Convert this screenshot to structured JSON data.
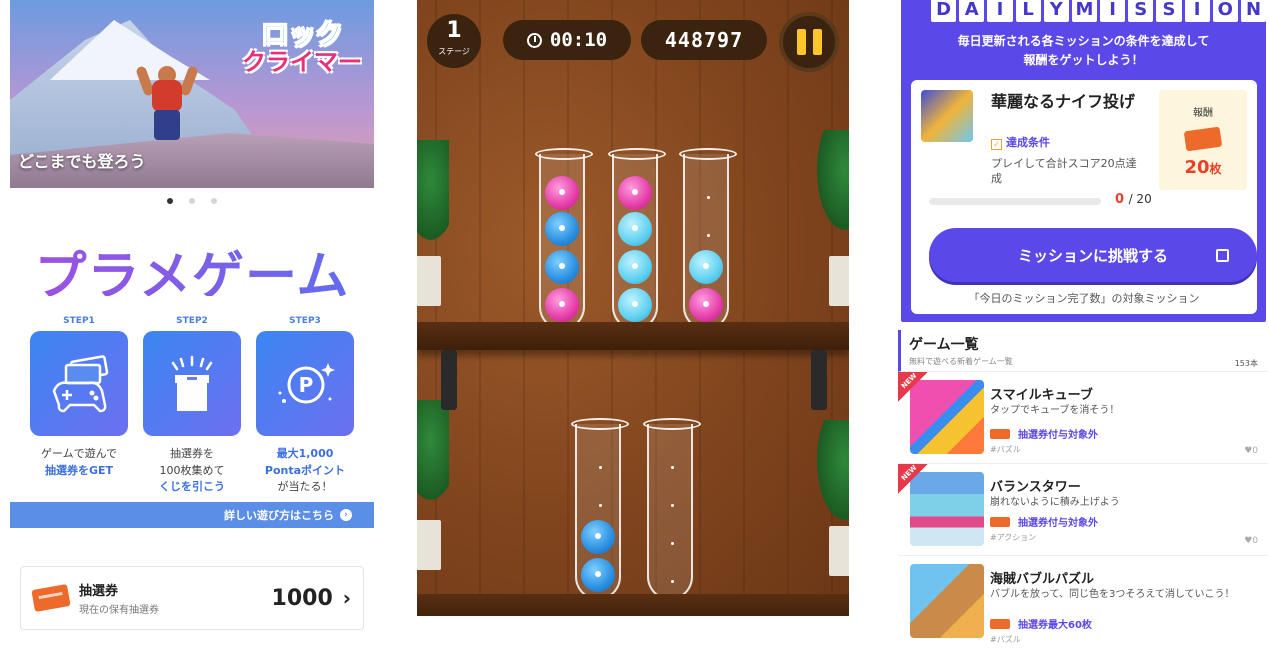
{
  "left": {
    "banner": {
      "title_line1": "ロック",
      "title_line2": "クライマー",
      "caption": "どこまでも登ろう"
    },
    "logo": "プラメゲーム",
    "steps": [
      {
        "label": "STEP1",
        "line1": "ゲームで遊んで",
        "line2": "抽選券をGET",
        "line3": ""
      },
      {
        "label": "STEP2",
        "line1": "抽選券を",
        "line2": "100枚集めて",
        "line3": "くじを引こう"
      },
      {
        "label": "STEP3",
        "line1": "最大1,000",
        "line2": "Pontaポイント",
        "line3": "が当たる！"
      }
    ],
    "howto_link": "詳しい遊び方はこちら",
    "ticket": {
      "title": "抽選券",
      "subtitle": "現在の保有抽選券",
      "count": "1000",
      "arrow": "›"
    }
  },
  "game": {
    "stage_number": "1",
    "stage_label": "ステージ",
    "timer": "00:10",
    "score": "448797"
  },
  "right": {
    "daily_letters": [
      "D",
      "A",
      "I",
      "L",
      "Y",
      "M",
      "I",
      "S",
      "S",
      "I",
      "O",
      "N"
    ],
    "daily_desc_line1": "毎日更新される各ミッションの条件を達成して",
    "daily_desc_line2": "報酬をゲットしよう！",
    "mission": {
      "title": "華麗なるナイフ投げ",
      "condition_label": "達成条件",
      "condition_text": "プレイして合計スコア20点達成",
      "reward_label": "報酬",
      "reward_count": "20",
      "reward_unit": "枚",
      "progress_current": "0",
      "progress_total": "/ 20",
      "progress_fraction": 0,
      "button": "ミッションに挑戦する",
      "note": "「今日のミッション完了数」の対象ミッション"
    },
    "game_list": {
      "title": "ゲーム一覧",
      "subtitle": "無料で遊べる新着ゲーム一覧",
      "count": "153本",
      "items": [
        {
          "name": "スマイルキューブ",
          "desc": "タップでキューブを消そう！",
          "ticket": "抽選券付与対象外",
          "tag": "#パズル",
          "fav": "♥0",
          "new": "NEW"
        },
        {
          "name": "バランスタワー",
          "desc": "崩れないように積み上げよう",
          "ticket": "抽選券付与対象外",
          "tag": "#アクション",
          "fav": "♥0",
          "new": "NEW"
        },
        {
          "name": "海賊バブルパズル",
          "desc": "バブルを放って、同じ色を3つそろえて消していこう！",
          "ticket": "抽選券最大60枚",
          "tag": "#パズル",
          "fav": "",
          "new": ""
        }
      ]
    }
  }
}
